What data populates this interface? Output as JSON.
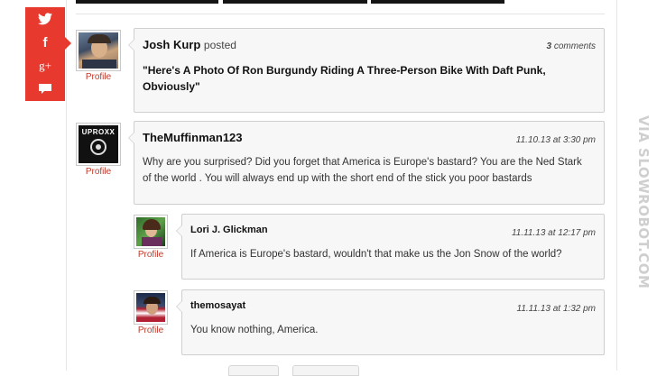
{
  "share": {
    "buttons": [
      {
        "icon": "twitter-icon",
        "glyph": "🐦"
      },
      {
        "icon": "facebook-icon",
        "glyph": "f"
      },
      {
        "icon": "google-plus-icon",
        "glyph": "g+"
      },
      {
        "icon": "comment-icon",
        "glyph": ""
      }
    ],
    "color": "#e8392f"
  },
  "watermark": "VIA SLOWROBOT.COM",
  "post": {
    "author": "Josh Kurp",
    "verb": "posted",
    "comments_count": "3",
    "comments_label": "comments",
    "headline": "\"Here's A Photo Of Ron Burgundy Riding A Three-Person Bike With Daft Punk, Obviously\"",
    "profile_label": "Profile"
  },
  "comments": [
    {
      "author": "TheMuffinman123",
      "date": "11.10.13 at 3:30 pm",
      "text": "Why are you surprised? Did you forget that America is Europe's bastard? You are the Ned Stark of the world . You will always end up with the short end of the stick you poor bastards",
      "profile_label": "Profile",
      "avatar_text": "UPROXX"
    },
    {
      "author": "Lori J. Glickman",
      "date": "11.11.13 at 12:17 pm",
      "text": "If America is Europe's bastard, wouldn't that make us the Jon Snow of the world?",
      "profile_label": "Profile"
    },
    {
      "author": "themosayat",
      "date": "11.11.13 at 1:32 pm",
      "text": "You know nothing, America.",
      "profile_label": "Profile"
    }
  ]
}
